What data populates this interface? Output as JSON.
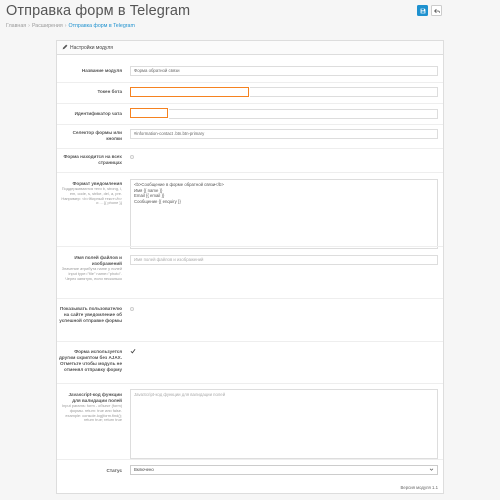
{
  "header": {
    "title": "Отправка форм в Telegram",
    "breadcrumb": [
      "Главная",
      "Расширения",
      "Отправка форм в Telegram"
    ]
  },
  "panel": {
    "heading": "Настройки модуля"
  },
  "fields": {
    "module_name": {
      "label": "Название модуля",
      "value": "Форма обратной связи"
    },
    "bot_token": {
      "label": "Токен бота",
      "value": ""
    },
    "chat_id": {
      "label": "Идентификатор чата",
      "value": ""
    },
    "form_selector": {
      "label": "Селектор формы или кнопки",
      "value": "#information-contact .btn.btn-primary"
    },
    "all_pages": {
      "label": "Форма находится на всех страницах",
      "checked": false
    },
    "notify_format": {
      "label": "Формат уведомления",
      "help": "Поддерживаются теги b, strong, i, em, code, s, strike, del, a, pre. Например: <b>Жирный текст</b> и ... {{ phone }}",
      "value": "<b>Сообщение в форме обратной связи</b>\nИмя {{ name }}\nEmail {{ email }}\nСообщение {{ enquiry }}"
    },
    "file_fields": {
      "label": "Имя полей файлов и изображений",
      "help": "Значение атрибута name у полей input type=\"file\" name=\"photo\". Через запятую, если несколько",
      "placeholder": "Имя полей файлов и изображений"
    },
    "show_success": {
      "label": "Показывать пользователю на сайте уведомление об успешной отправке формы",
      "checked": false
    },
    "ajax_form": {
      "label": "Форма используется другим скриптом без AJAX. Отметьте чтобы модуль не отменял отправку форму",
      "checked": true
    },
    "js_validation": {
      "label": "Javascript-код функции для валидации полей",
      "help": "Input params: form - объект (form) формы. return: true или false. example: console.log(form.find(); return true; return true",
      "placeholder": "JavaScript-код функции для валидации полей"
    },
    "status": {
      "label": "Статус",
      "value": "Включено"
    }
  },
  "footer": {
    "version": "Версия модуля 1.1"
  },
  "colors": {
    "primary": "#1e91cf",
    "highlight": "#f58220"
  },
  "icons": [
    "save-icon",
    "back-icon",
    "pencil-icon",
    "check-icon",
    "chevron-down-icon"
  ]
}
